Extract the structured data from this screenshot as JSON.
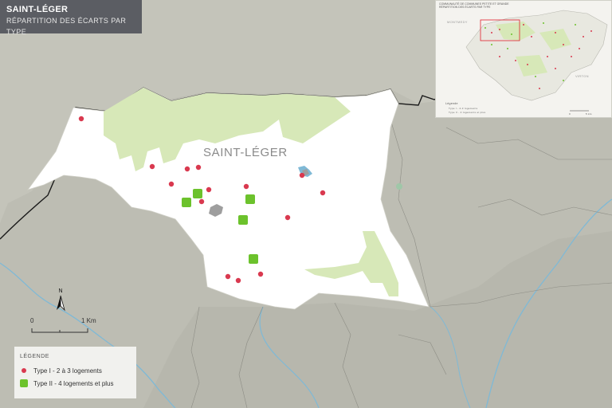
{
  "title": "SAINT-LÉGER",
  "subtitle": "RÉPARTITION DES ÉCARTS PAR TYPE",
  "commune_label": "SAINT-LÉGER",
  "legend": {
    "title": "LÉGENDE",
    "items": [
      {
        "label": "Type I - 2 à 3 logements",
        "symbol": "circle",
        "color": "#d9394f"
      },
      {
        "label": "Type II - 4 logements et plus",
        "symbol": "square",
        "color": "#6cc22c"
      }
    ]
  },
  "scale": {
    "start": "0",
    "end": "1 Km"
  },
  "north_label": "N",
  "inset": {
    "title_line1": "COMMUNAUTÉ DE COMMUNES PETITE ET GRANDE",
    "title_line2": "RÉPARTITION DES ÉCARTS PAR TYPE",
    "label_a": "MONTMEDY",
    "label_b": "VIRTON",
    "legend_title": "Légende",
    "legend_1": "Type I - 2-3 logements",
    "legend_2": "Type II - 4 logements et plus",
    "scale_start": "0",
    "scale_end": "5 km"
  },
  "colors": {
    "background": "#bdbdb3",
    "commune": "#ffffff",
    "green_area": "#d7e8b8",
    "water": "#7fb9d6",
    "border": "#1a1a1a",
    "type_i": "#d9394f",
    "type_ii": "#6cc22c"
  }
}
